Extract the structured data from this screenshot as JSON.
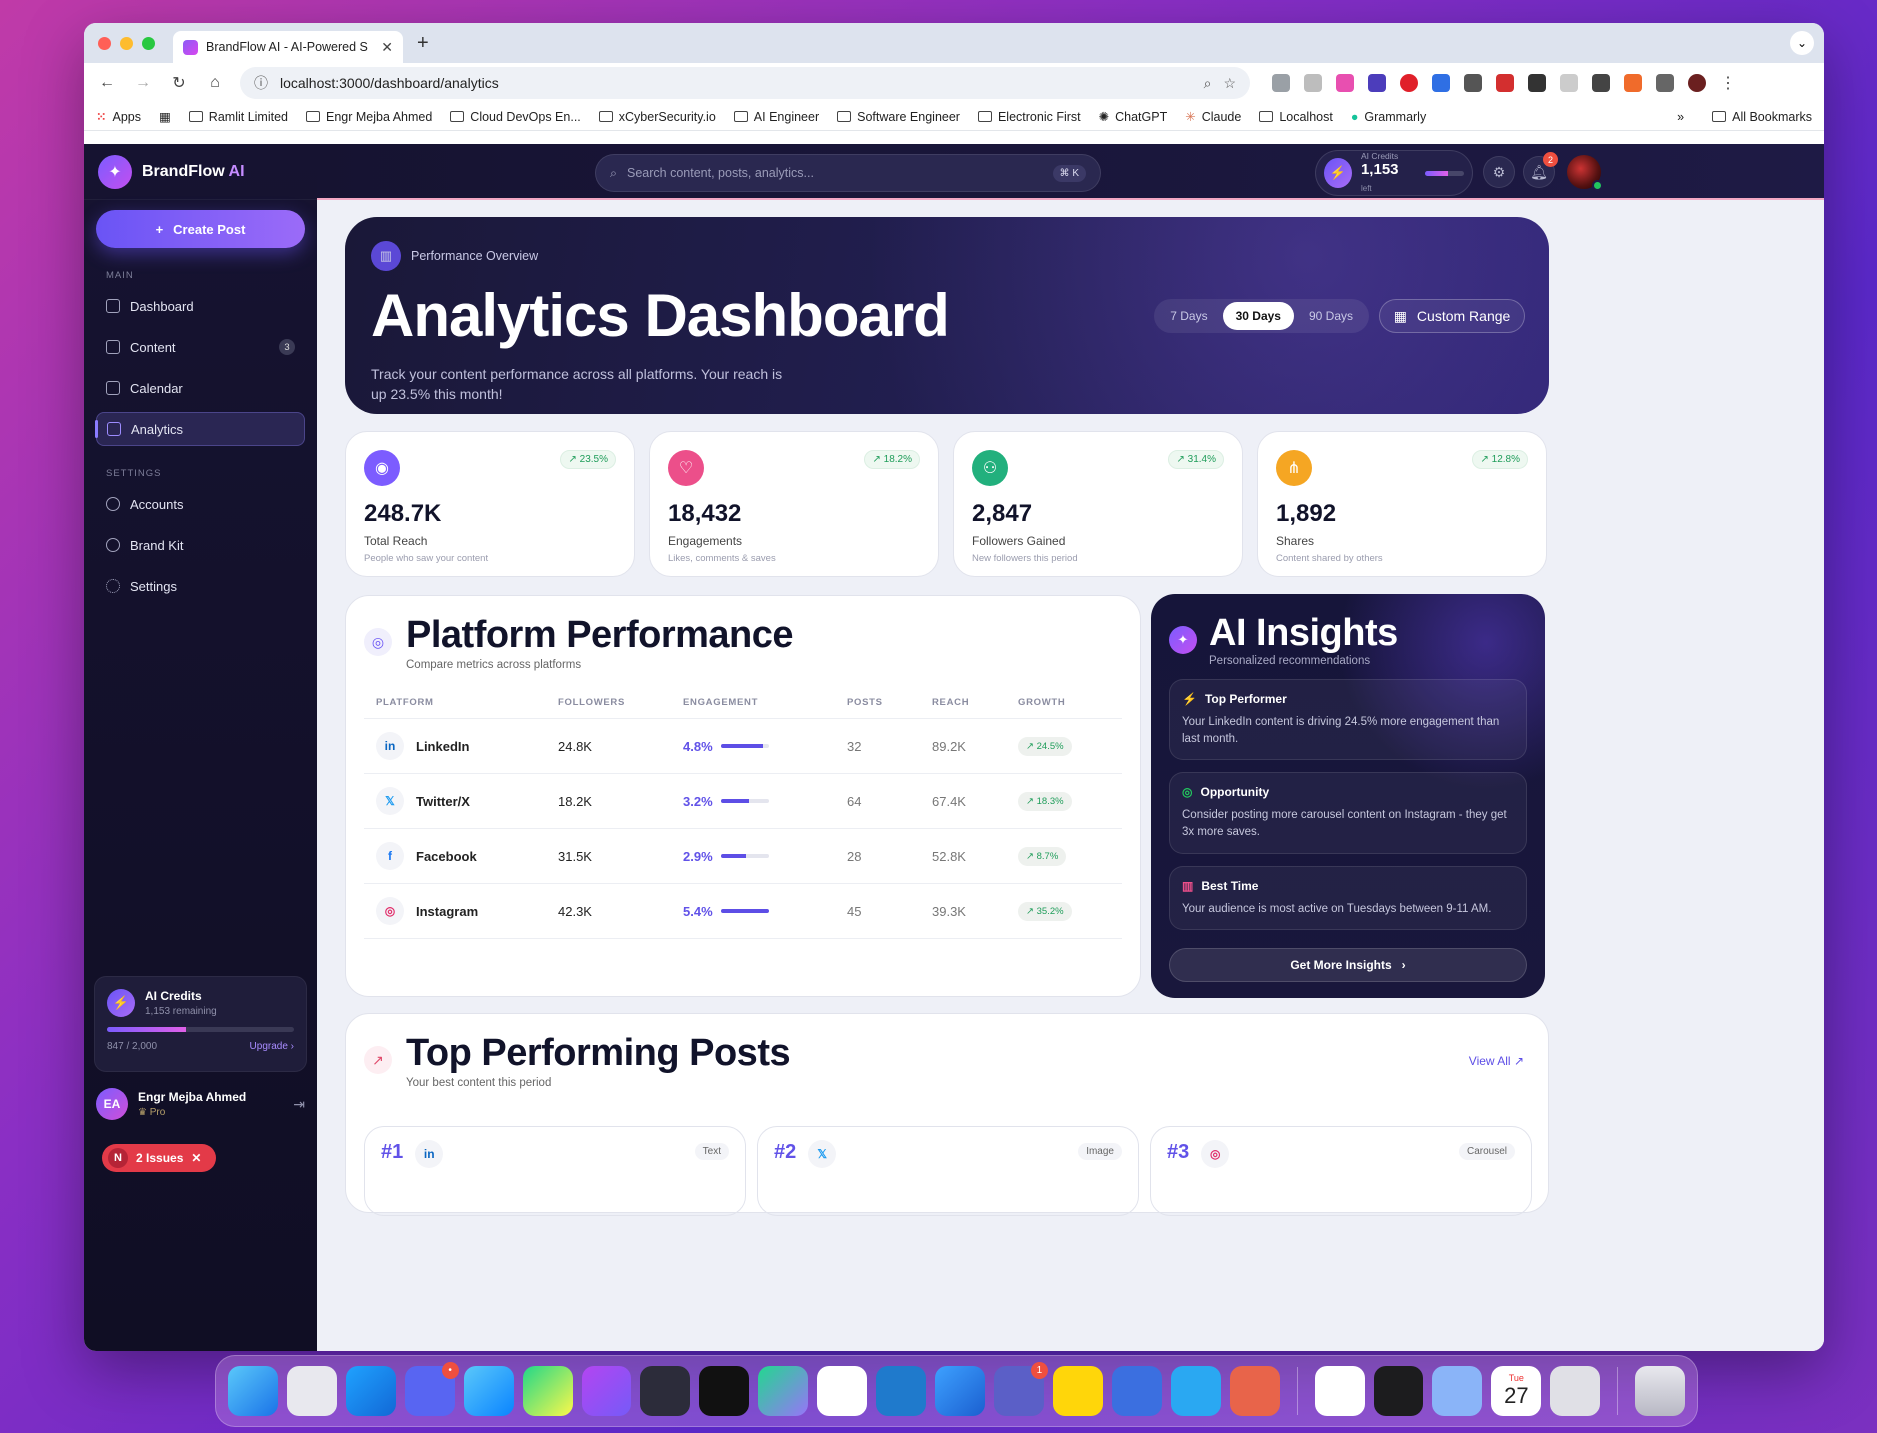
{
  "browser": {
    "tab_title": "BrandFlow AI - AI-Powered S",
    "url": "localhost:3000/dashboard/analytics",
    "bookmarks": [
      "Apps",
      "Ramlit Limited",
      "Engr Mejba Ahmed",
      "Cloud DevOps En...",
      "xCyberSecurity.io",
      "AI Engineer",
      "Software Engineer",
      "Electronic First",
      "ChatGPT",
      "Claude",
      "Localhost",
      "Grammarly"
    ],
    "all_bookmarks": "All Bookmarks"
  },
  "sidebar": {
    "brand_name": "BrandFlow",
    "brand_ai": "AI",
    "create_post": "Create Post",
    "main_label": "MAIN",
    "main_items": [
      {
        "label": "Dashboard"
      },
      {
        "label": "Content",
        "badge": "3"
      },
      {
        "label": "Calendar"
      },
      {
        "label": "Analytics"
      }
    ],
    "settings_label": "SETTINGS",
    "settings_items": [
      {
        "label": "Accounts"
      },
      {
        "label": "Brand Kit"
      },
      {
        "label": "Settings"
      }
    ],
    "credits": {
      "title": "AI Credits",
      "remaining": "1,153 remaining",
      "usage": "847 / 2,000",
      "used_fraction": 0.4235,
      "upgrade": "Upgrade"
    },
    "user": {
      "initials": "EA",
      "name": "Engr Mejba Ahmed",
      "plan": "Pro"
    },
    "issues": {
      "count": "N",
      "label": "2 Issues"
    }
  },
  "topbar": {
    "search_placeholder": "Search content, posts, analytics...",
    "shortcut": "⌘ K",
    "credits_label": "AI Credits",
    "credits_value": "1,153",
    "credits_unit": "left",
    "credits_fraction": 0.58,
    "notifications": "2"
  },
  "hero": {
    "tag": "Performance Overview",
    "title": "Analytics Dashboard",
    "description": "Track your content performance across all platforms. Your reach is up 23.5% this month!",
    "ranges": [
      "7 Days",
      "30 Days",
      "90 Days"
    ],
    "selected_range": "30 Days",
    "custom_range": "Custom Range"
  },
  "stats": [
    {
      "value": "248.7K",
      "label": "Total Reach",
      "sub": "People who saw your content",
      "growth": "23.5%",
      "color": "#7c5cff"
    },
    {
      "value": "18,432",
      "label": "Engagements",
      "sub": "Likes, comments & saves",
      "growth": "18.2%",
      "color": "#ec4f8a"
    },
    {
      "value": "2,847",
      "label": "Followers Gained",
      "sub": "New followers this period",
      "growth": "31.4%",
      "color": "#22b07d"
    },
    {
      "value": "1,892",
      "label": "Shares",
      "sub": "Content shared by others",
      "growth": "12.8%",
      "color": "#f5a623"
    }
  ],
  "platform": {
    "title": "Platform Performance",
    "subtitle": "Compare metrics across platforms",
    "headers": [
      "PLATFORM",
      "FOLLOWERS",
      "ENGAGEMENT",
      "POSTS",
      "REACH",
      "GROWTH"
    ],
    "rows": [
      {
        "name": "LinkedIn",
        "followers": "24.8K",
        "engagement": "4.8%",
        "eng_value": 4.8,
        "posts": "32",
        "reach": "89.2K",
        "growth": "24.5%",
        "logo": "in",
        "logo_color": "#0a66c2"
      },
      {
        "name": "Twitter/X",
        "followers": "18.2K",
        "engagement": "3.2%",
        "eng_value": 3.2,
        "posts": "64",
        "reach": "67.4K",
        "growth": "18.3%",
        "logo": "𝕏",
        "logo_color": "#1d9bf0"
      },
      {
        "name": "Facebook",
        "followers": "31.5K",
        "engagement": "2.9%",
        "eng_value": 2.9,
        "posts": "28",
        "reach": "52.8K",
        "growth": "8.7%",
        "logo": "f",
        "logo_color": "#1877f2"
      },
      {
        "name": "Instagram",
        "followers": "42.3K",
        "engagement": "5.4%",
        "eng_value": 5.4,
        "posts": "45",
        "reach": "39.3K",
        "growth": "35.2%",
        "logo": "◎",
        "logo_color": "#e1306c"
      }
    ]
  },
  "insights": {
    "title": "AI Insights",
    "subtitle": "Personalized recommendations",
    "items": [
      {
        "title": "Top Performer",
        "text": "Your LinkedIn content is driving 24.5% more engagement than last month.",
        "icon": "bolt-icon",
        "color": "#f5c542"
      },
      {
        "title": "Opportunity",
        "text": "Consider posting more carousel content on Instagram - they get 3x more saves.",
        "icon": "target-icon",
        "color": "#22c55e"
      },
      {
        "title": "Best Time",
        "text": "Your audience is most active on Tuesdays between 9-11 AM.",
        "icon": "chart-icon",
        "color": "#ec4f8a"
      }
    ],
    "button": "Get More Insights"
  },
  "posts": {
    "title": "Top Performing Posts",
    "subtitle": "Your best content this period",
    "view_all": "View All",
    "items": [
      {
        "rank": "#1",
        "logo": "in",
        "logo_color": "#0a66c2",
        "type": "Text"
      },
      {
        "rank": "#2",
        "logo": "𝕏",
        "logo_color": "#1d9bf0",
        "type": "Image"
      },
      {
        "rank": "#3",
        "logo": "◎",
        "logo_color": "#e1306c",
        "type": "Carousel"
      }
    ]
  },
  "dock": {
    "calendar_day": "Tue",
    "calendar_date": "27",
    "discord_badge": "",
    "teams_badge": "1"
  }
}
